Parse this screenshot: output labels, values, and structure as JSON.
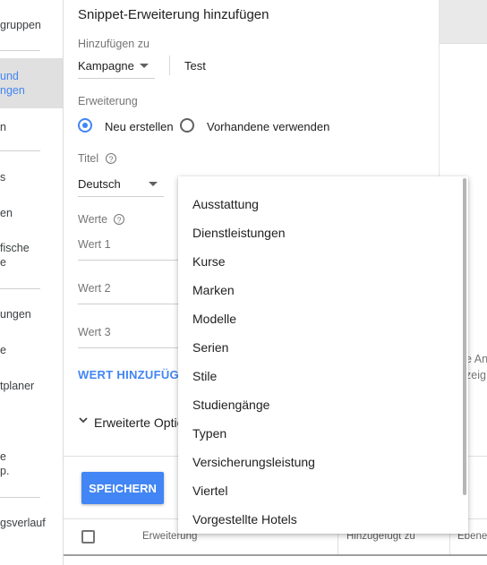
{
  "sidebar": {
    "items": [
      {
        "label": "gruppen"
      },
      {
        "label": "und"
      },
      {
        "label": "ngen"
      },
      {
        "label": "n"
      },
      {
        "label": "s"
      },
      {
        "label": "en"
      },
      {
        "label": "fische"
      },
      {
        "label": "e"
      },
      {
        "label": "ungen"
      },
      {
        "label": "e"
      },
      {
        "label": "tplaner"
      },
      {
        "label": "e"
      },
      {
        "label": "p."
      },
      {
        "label": "gsverlauf"
      }
    ]
  },
  "panel": {
    "title": "Snippet-Erweiterung hinzufügen",
    "add_to": {
      "label": "Hinzufügen zu",
      "level": "Kampagne",
      "campaign": "Test"
    },
    "extension": {
      "label": "Erweiterung",
      "options": [
        {
          "label": "Neu erstellen",
          "checked": true
        },
        {
          "label": "Vorhandene verwenden",
          "checked": false
        }
      ]
    },
    "title_field": {
      "label": "Titel",
      "language": "Deutsch"
    },
    "values": {
      "label": "Werte",
      "placeholders": [
        "Wert 1",
        "Wert 2",
        "Wert 3"
      ],
      "add_label": "WERT HINZUFÜGEN"
    },
    "advanced_label": "Erweiterte Optionen"
  },
  "footer": {
    "save_label": "SPEICHERN"
  },
  "table": {
    "headers": [
      "Erweiterung",
      "Hinzugefügt zu",
      "Ebene"
    ]
  },
  "background_text": [
    "e Anz",
    "zeig"
  ],
  "dropdown": {
    "options": [
      "Ausstattung",
      "Dienstleistungen",
      "Kurse",
      "Marken",
      "Modelle",
      "Serien",
      "Stile",
      "Studiengänge",
      "Typen",
      "Versicherungsleistung",
      "Viertel",
      "Vorgestellte Hotels"
    ]
  },
  "colors": {
    "accent": "#4285f4",
    "text": "#212121",
    "muted": "#757575"
  }
}
